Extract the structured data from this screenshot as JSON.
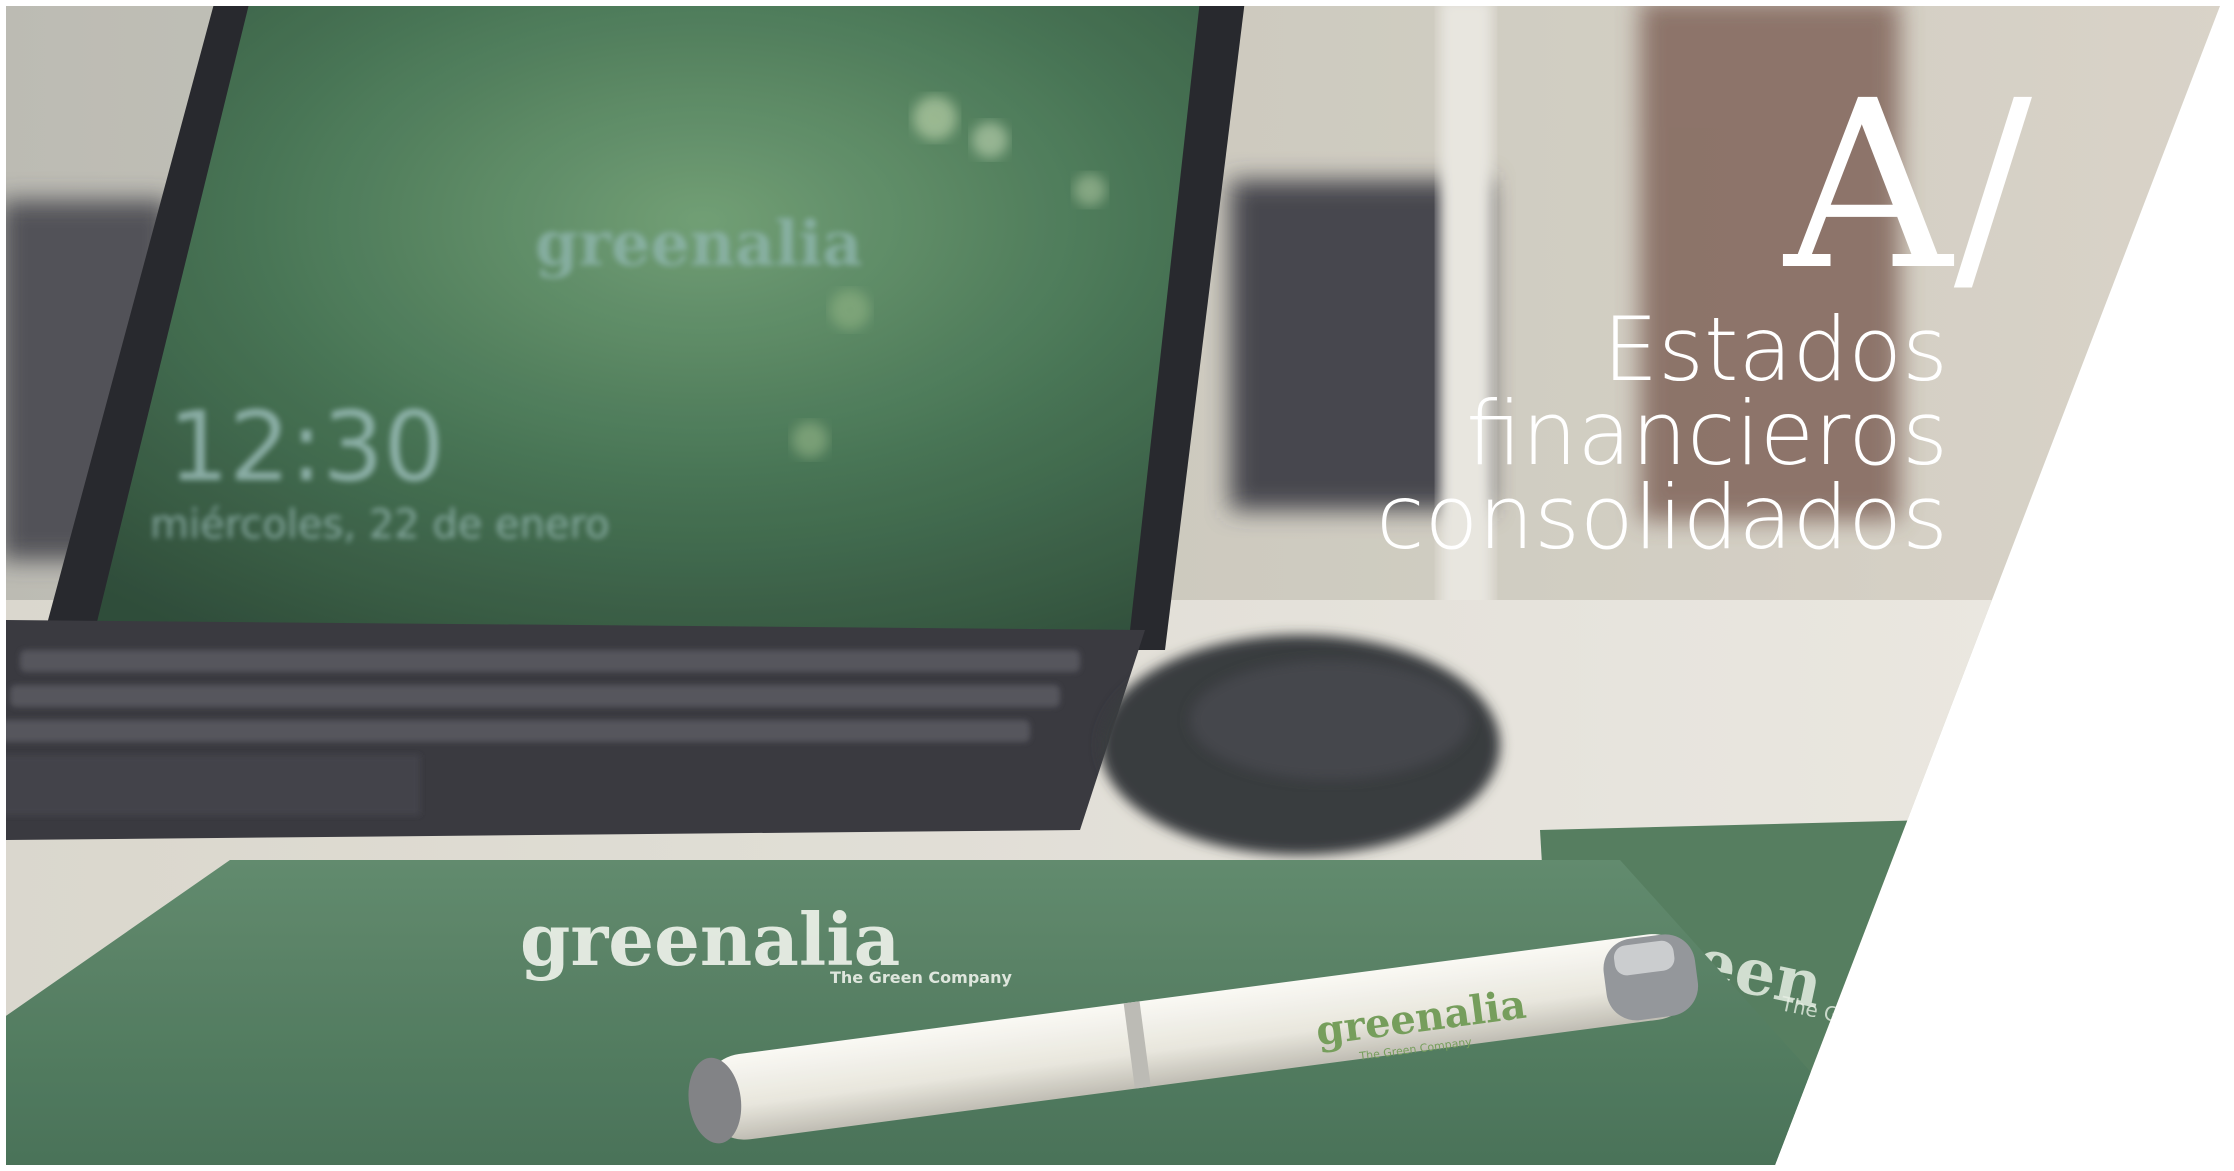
{
  "section": {
    "letter": "A/",
    "title_lines": [
      "Estados",
      "financieros",
      "consolidados"
    ]
  },
  "photo": {
    "laptop_clock": "12:30",
    "laptop_date": "miércoles, 22 de enero",
    "laptop_logo": "greenalia",
    "folder_logo": "greenalia",
    "folder_tagline": "The Green Company",
    "folder2_logo": "green",
    "folder2_tagline": "The G",
    "pen_logo": "greenalia",
    "pen_tagline": "The Green Company"
  },
  "colors": {
    "brand_green": "#5f8f6a",
    "folder_green": "#4e7a5a",
    "background": "#ffffff"
  }
}
